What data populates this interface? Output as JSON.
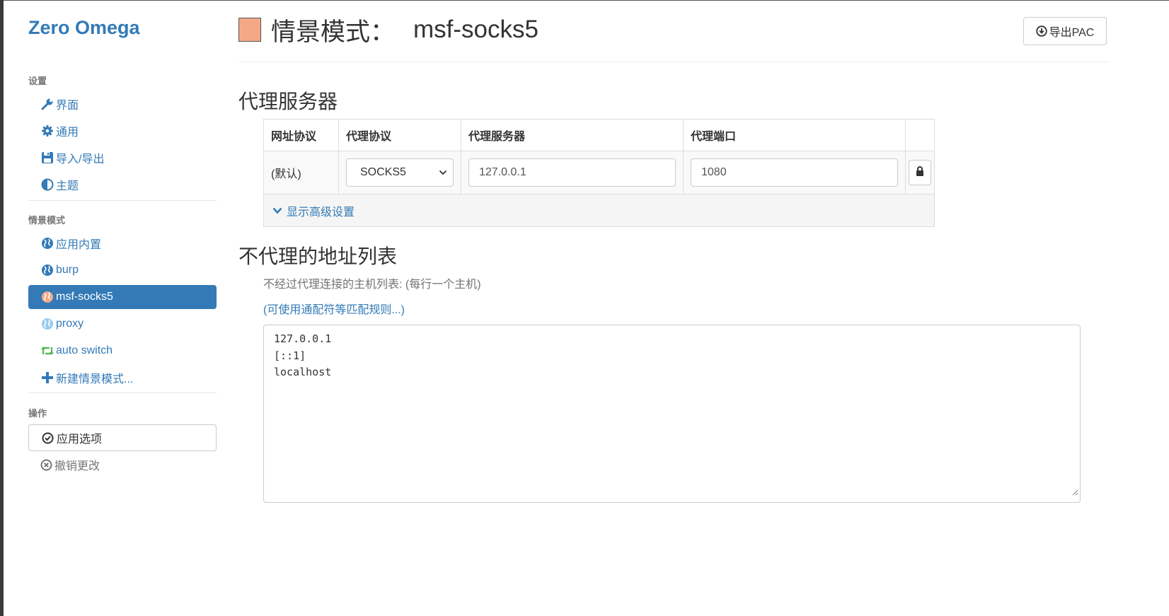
{
  "app": {
    "brand": "Zero Omega"
  },
  "sidebar": {
    "settings_header": "设置",
    "settings_items": [
      {
        "label": "界面",
        "icon": "wrench-icon"
      },
      {
        "label": "通用",
        "icon": "gear-icon"
      },
      {
        "label": "导入/导出",
        "icon": "floppy-disk-icon"
      },
      {
        "label": "主题",
        "icon": "contrast-icon"
      }
    ],
    "profiles_header": "情景模式",
    "profile_items": [
      {
        "label": "应用内置",
        "icon": "globe-icon",
        "color": "#337ab7"
      },
      {
        "label": "burp",
        "icon": "globe-icon",
        "color": "#337ab7"
      },
      {
        "label": "msf-socks5",
        "icon": "globe-icon",
        "color": "#f5a886",
        "active": true
      },
      {
        "label": "proxy",
        "icon": "globe-icon",
        "color": "#99ccee"
      },
      {
        "label": "auto switch",
        "icon": "retweet-icon",
        "color": "#5cb85c"
      },
      {
        "label": "新建情景模式...",
        "icon": "plus-icon",
        "color": "#337ab7"
      }
    ],
    "actions_header": "操作",
    "apply_label": "应用选项",
    "undo_label": "撤销更改"
  },
  "header": {
    "title_label": "情景模式：",
    "profile_name": "msf-socks5",
    "profile_color": "#f5a886",
    "export_label": "导出PAC"
  },
  "proxy": {
    "section_title": "代理服务器",
    "columns": [
      "网址协议",
      "代理协议",
      "代理服务器",
      "代理端口"
    ],
    "row": {
      "scheme": "(默认)",
      "protocol": "SOCKS5",
      "server": "127.0.0.1",
      "port": "1080"
    },
    "advanced_label": "显示高级设置"
  },
  "bypass": {
    "section_title": "不代理的地址列表",
    "help_text": "不经过代理连接的主机列表: (每行一个主机)",
    "help_link": "(可使用通配符等匹配规则...)",
    "lines": [
      "127.0.0.1",
      "[::1]",
      "localhost"
    ]
  }
}
